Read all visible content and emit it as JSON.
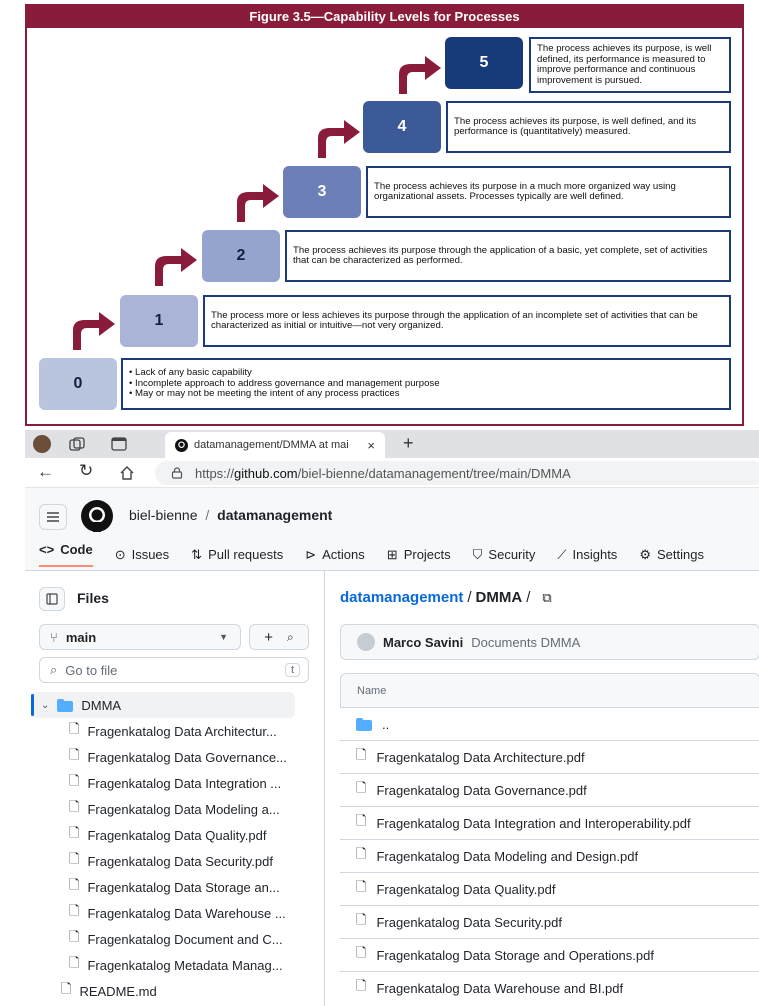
{
  "figure": {
    "title": "Figure 3.5—Capability Levels for Processes",
    "levels": [
      {
        "level": "0",
        "items": [
          "• Lack of any basic capability",
          "• Incomplete approach to address governance and management purpose",
          "• May or may not be meeting the intent of any process practices"
        ]
      },
      {
        "level": "1",
        "text": "The process more or less achieves its purpose through the application of an incomplete set of activities that can be characterized as initial or intuitive—not very organized."
      },
      {
        "level": "2",
        "text": "The process achieves its purpose through the application of a basic, yet complete, set of activities that can be characterized as performed."
      },
      {
        "level": "3",
        "text": "The process achieves its purpose in a much more organized way using organizational assets. Processes typically are well defined."
      },
      {
        "level": "4",
        "text": "The process achieves its purpose, is well defined, and its performance is (quantitatively) measured."
      },
      {
        "level": "5",
        "text": "The process achieves its purpose, is well defined, its performance is measured to improve performance and continuous improvement is pursued."
      }
    ],
    "colors": {
      "accent": "#8a1c3b",
      "step0": "#b9c4de",
      "step1": "#a9b4d6",
      "step2": "#94a4cf",
      "step3": "#6c7fb6",
      "step4": "#3c5a97",
      "step5": "#173a78",
      "border": "#1c3b7a"
    }
  },
  "browser": {
    "tab_title": "datamanagement/DMMA at mai",
    "url_prefix": "https://",
    "url_domain": "github.com",
    "url_path": "/biel-bienne/datamanagement/tree/main/DMMA"
  },
  "github": {
    "owner": "biel-bienne",
    "separator": "/",
    "repo": "datamanagement",
    "nav": [
      "Code",
      "Issues",
      "Pull requests",
      "Actions",
      "Projects",
      "Security",
      "Insights",
      "Settings"
    ],
    "sidebar": {
      "title": "Files",
      "branch": "main",
      "search_placeholder": "Go to file",
      "search_shortcut": "t",
      "folder": "DMMA",
      "files": [
        "Fragenkatalog Data Architectur...",
        "Fragenkatalog Data Governance...",
        "Fragenkatalog Data Integration ...",
        "Fragenkatalog Data Modeling a...",
        "Fragenkatalog Data Quality.pdf",
        "Fragenkatalog Data Security.pdf",
        "Fragenkatalog Data Storage an...",
        "Fragenkatalog Data Warehouse ...",
        "Fragenkatalog Document and C...",
        "Fragenkatalog Metadata Manag..."
      ],
      "readme": "README.md"
    },
    "main": {
      "breadcrumb_repo": "datamanagement",
      "breadcrumb_sep": "/",
      "breadcrumb_folder": "DMMA",
      "breadcrumb_trail": "/",
      "commit_author": "Marco Savini",
      "commit_message": "Documents DMMA",
      "column_name": "Name",
      "parent_dir": "..",
      "files": [
        "Fragenkatalog Data Architecture.pdf",
        "Fragenkatalog Data Governance.pdf",
        "Fragenkatalog Data Integration and Interoperability.pdf",
        "Fragenkatalog Data Modeling and Design.pdf",
        "Fragenkatalog Data Quality.pdf",
        "Fragenkatalog Data Security.pdf",
        "Fragenkatalog Data Storage and Operations.pdf",
        "Fragenkatalog Data Warehouse and BI.pdf"
      ]
    }
  }
}
